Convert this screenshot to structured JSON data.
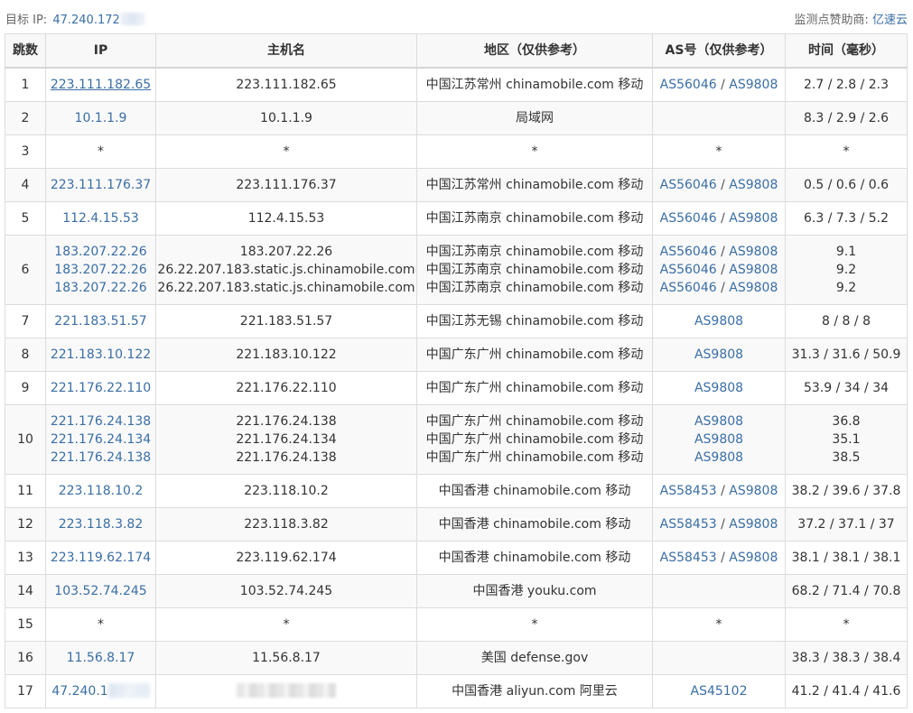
{
  "header": {
    "target_label": "目标 IP:",
    "target_ip_visible": "47.240.172",
    "sponsor_label": "监测点赞助商:",
    "sponsor_name": "亿速云"
  },
  "table": {
    "columns": [
      "跳数",
      "IP",
      "主机名",
      "地区（仅供参考）",
      "AS号（仅供参考）",
      "时间（毫秒）"
    ],
    "rows": [
      {
        "hop": "1",
        "entries": [
          {
            "ip": "223.111.182.65",
            "host": "223.111.182.65",
            "region": "中国江苏常州 chinamobile.com 移动",
            "as": [
              "AS56046",
              "AS9808"
            ]
          }
        ],
        "time": [
          "2.7 / 2.8 / 2.3"
        ]
      },
      {
        "hop": "2",
        "entries": [
          {
            "ip": "10.1.1.9",
            "host": "10.1.1.9",
            "region": "局域网",
            "as": []
          }
        ],
        "time": [
          "8.3 / 2.9 / 2.6"
        ]
      },
      {
        "hop": "3",
        "entries": [
          {
            "ip": "*",
            "host": "*",
            "region": "*",
            "as": [
              "*"
            ]
          }
        ],
        "time": [
          "*"
        ]
      },
      {
        "hop": "4",
        "entries": [
          {
            "ip": "223.111.176.37",
            "host": "223.111.176.37",
            "region": "中国江苏常州 chinamobile.com 移动",
            "as": [
              "AS56046",
              "AS9808"
            ]
          }
        ],
        "time": [
          "0.5 / 0.6 / 0.6"
        ]
      },
      {
        "hop": "5",
        "entries": [
          {
            "ip": "112.4.15.53",
            "host": "112.4.15.53",
            "region": "中国江苏南京 chinamobile.com 移动",
            "as": [
              "AS56046",
              "AS9808"
            ]
          }
        ],
        "time": [
          "6.3 / 7.3 / 5.2"
        ]
      },
      {
        "hop": "6",
        "entries": [
          {
            "ip": "183.207.22.26",
            "host": "183.207.22.26",
            "region": "中国江苏南京 chinamobile.com 移动",
            "as": [
              "AS56046",
              "AS9808"
            ]
          },
          {
            "ip": "183.207.22.26",
            "host": "26.22.207.183.static.js.chinamobile.com",
            "region": "中国江苏南京 chinamobile.com 移动",
            "as": [
              "AS56046",
              "AS9808"
            ]
          },
          {
            "ip": "183.207.22.26",
            "host": "26.22.207.183.static.js.chinamobile.com",
            "region": "中国江苏南京 chinamobile.com 移动",
            "as": [
              "AS56046",
              "AS9808"
            ]
          }
        ],
        "time": [
          "9.1",
          "9.2",
          "9.2"
        ]
      },
      {
        "hop": "7",
        "entries": [
          {
            "ip": "221.183.51.57",
            "host": "221.183.51.57",
            "region": "中国江苏无锡 chinamobile.com 移动",
            "as": [
              "AS9808"
            ]
          }
        ],
        "time": [
          "8 / 8 / 8"
        ]
      },
      {
        "hop": "8",
        "entries": [
          {
            "ip": "221.183.10.122",
            "host": "221.183.10.122",
            "region": "中国广东广州 chinamobile.com 移动",
            "as": [
              "AS9808"
            ]
          }
        ],
        "time": [
          "31.3 / 31.6 / 50.9"
        ]
      },
      {
        "hop": "9",
        "entries": [
          {
            "ip": "221.176.22.110",
            "host": "221.176.22.110",
            "region": "中国广东广州 chinamobile.com 移动",
            "as": [
              "AS9808"
            ]
          }
        ],
        "time": [
          "53.9 / 34 / 34"
        ]
      },
      {
        "hop": "10",
        "entries": [
          {
            "ip": "221.176.24.138",
            "host": "221.176.24.138",
            "region": "中国广东广州 chinamobile.com 移动",
            "as": [
              "AS9808"
            ]
          },
          {
            "ip": "221.176.24.134",
            "host": "221.176.24.134",
            "region": "中国广东广州 chinamobile.com 移动",
            "as": [
              "AS9808"
            ]
          },
          {
            "ip": "221.176.24.138",
            "host": "221.176.24.138",
            "region": "中国广东广州 chinamobile.com 移动",
            "as": [
              "AS9808"
            ]
          }
        ],
        "time": [
          "36.8",
          "35.1",
          "38.5"
        ]
      },
      {
        "hop": "11",
        "entries": [
          {
            "ip": "223.118.10.2",
            "host": "223.118.10.2",
            "region": "中国香港 chinamobile.com 移动",
            "as": [
              "AS58453",
              "AS9808"
            ]
          }
        ],
        "time": [
          "38.2 / 39.6 / 37.8"
        ]
      },
      {
        "hop": "12",
        "entries": [
          {
            "ip": "223.118.3.82",
            "host": "223.118.3.82",
            "region": "中国香港 chinamobile.com 移动",
            "as": [
              "AS58453",
              "AS9808"
            ]
          }
        ],
        "time": [
          "37.2 / 37.1 / 37"
        ]
      },
      {
        "hop": "13",
        "entries": [
          {
            "ip": "223.119.62.174",
            "host": "223.119.62.174",
            "region": "中国香港 chinamobile.com 移动",
            "as": [
              "AS58453",
              "AS9808"
            ]
          }
        ],
        "time": [
          "38.1 / 38.1 / 38.1"
        ]
      },
      {
        "hop": "14",
        "entries": [
          {
            "ip": "103.52.74.245",
            "host": "103.52.74.245",
            "region": "中国香港 youku.com",
            "as": []
          }
        ],
        "time": [
          "68.2 / 71.4 / 70.8"
        ]
      },
      {
        "hop": "15",
        "entries": [
          {
            "ip": "*",
            "host": "*",
            "region": "*",
            "as": [
              "*"
            ]
          }
        ],
        "time": [
          "*"
        ]
      },
      {
        "hop": "16",
        "entries": [
          {
            "ip": "11.56.8.17",
            "host": "11.56.8.17",
            "region": "美国 defense.gov",
            "as": []
          }
        ],
        "time": [
          "38.3 / 38.3 / 38.4"
        ]
      },
      {
        "hop": "17",
        "entries": [
          {
            "ip": "47.240.1",
            "ip_masked": true,
            "host": "",
            "host_masked": true,
            "region": "中国香港 aliyun.com 阿里云",
            "as": [
              "AS45102"
            ]
          }
        ],
        "time": [
          "41.2 / 41.4 / 41.6"
        ]
      }
    ]
  },
  "colors": {
    "link": "#3a6ea5",
    "header_bg": "#f8f8f8",
    "border": "#dcdcdc",
    "text": "#333333"
  }
}
